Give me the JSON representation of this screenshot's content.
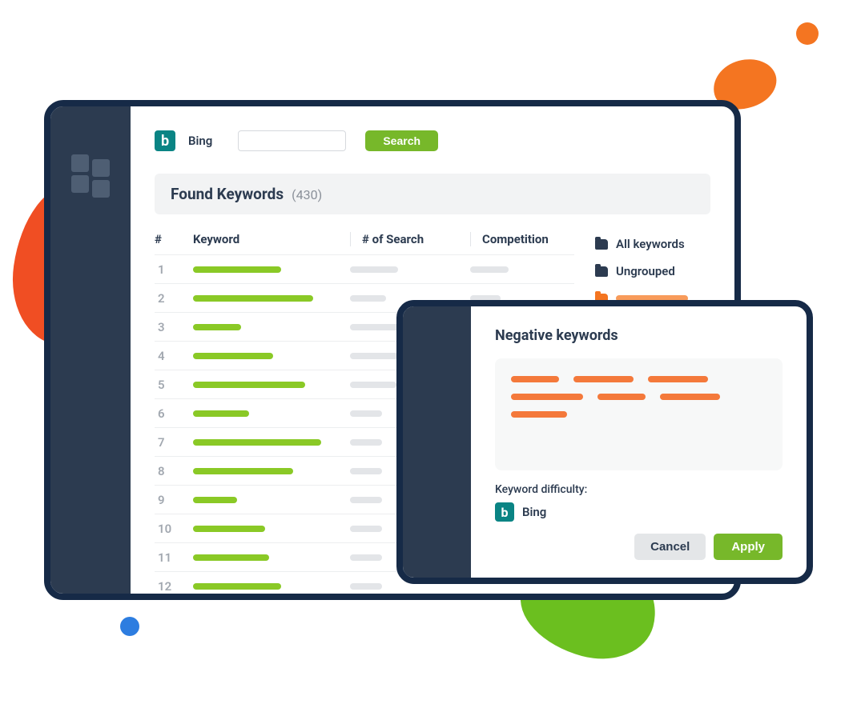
{
  "provider": {
    "name": "Bing",
    "glyph": "b"
  },
  "search": {
    "value": "",
    "button": "Search",
    "placeholder": ""
  },
  "found": {
    "title": "Found Keywords",
    "count": "(430)"
  },
  "columns": {
    "num": "#",
    "keyword": "Keyword",
    "searches": "# of Search",
    "competition": "Competition"
  },
  "rows": [
    {
      "n": "1",
      "kw": 110,
      "s": 60,
      "c": 48
    },
    {
      "n": "2",
      "kw": 150,
      "s": 45,
      "c": 38
    },
    {
      "n": "3",
      "kw": 60,
      "s": 80,
      "c": 0
    },
    {
      "n": "4",
      "kw": 100,
      "s": 60,
      "c": 0
    },
    {
      "n": "5",
      "kw": 140,
      "s": 58,
      "c": 0
    },
    {
      "n": "6",
      "kw": 70,
      "s": 40,
      "c": 0
    },
    {
      "n": "7",
      "kw": 160,
      "s": 40,
      "c": 0
    },
    {
      "n": "8",
      "kw": 125,
      "s": 40,
      "c": 0
    },
    {
      "n": "9",
      "kw": 55,
      "s": 40,
      "c": 0
    },
    {
      "n": "10",
      "kw": 90,
      "s": 40,
      "c": 0
    },
    {
      "n": "11",
      "kw": 95,
      "s": 40,
      "c": 0
    },
    {
      "n": "12",
      "kw": 110,
      "s": 40,
      "c": 0
    }
  ],
  "right": {
    "all": "All keywords",
    "ungrouped": "Ungrouped"
  },
  "popup": {
    "title": "Negative keywords",
    "tags": [
      60,
      75,
      75,
      90,
      60,
      75,
      70
    ],
    "kd_label": "Keyword difficulty:",
    "kd_provider": "Bing",
    "cancel": "Cancel",
    "apply": "Apply"
  }
}
